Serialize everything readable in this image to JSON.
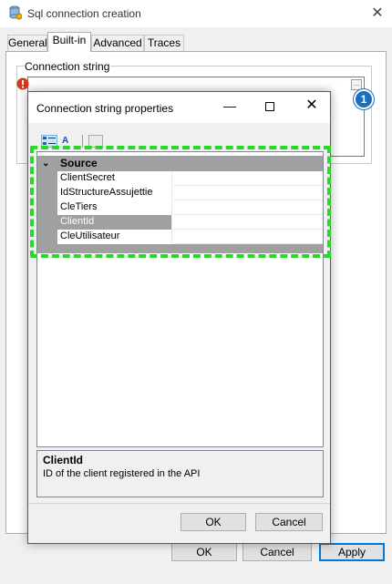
{
  "window": {
    "title": "Sql connection creation",
    "close_glyph": "✕",
    "title_icon": "database-settings-icon"
  },
  "tabs": [
    {
      "label": "General",
      "active": false
    },
    {
      "label": "Built-in",
      "active": true
    },
    {
      "label": "Advanced",
      "active": false
    },
    {
      "label": "Traces",
      "active": false
    }
  ],
  "connection": {
    "group_label": "Connection string",
    "value": "",
    "ellipsis_label": "...",
    "error_icon": "error-icon"
  },
  "badge": {
    "label": "1",
    "color": "#1c6fbf"
  },
  "footer": {
    "ok_label": "OK",
    "cancel_label": "Cancel",
    "apply_label": "Apply"
  },
  "dialog": {
    "title": "Connection string properties",
    "min_glyph": "—",
    "close_glyph": "✕",
    "toolbar": {
      "categorized_icon": "categorized-view-icon",
      "alpha_label": "A",
      "pages_icon": "property-pages-icon"
    },
    "category": {
      "label": "Source",
      "chevron": "⌄"
    },
    "properties": [
      {
        "name": "ClientSecret",
        "value": "",
        "selected": false
      },
      {
        "name": "IdStructureAssujettie",
        "value": "",
        "selected": false
      },
      {
        "name": "CleTiers",
        "value": "",
        "selected": false
      },
      {
        "name": "ClientId",
        "value": "",
        "selected": true
      },
      {
        "name": "CleUtilisateur",
        "value": "",
        "selected": false
      }
    ],
    "help": {
      "title": "ClientId",
      "description": "ID of the client registered in the API"
    },
    "ok_label": "OK",
    "cancel_label": "Cancel"
  },
  "colors": {
    "highlight": "#27d827",
    "grid_category": "#a0a0a0",
    "accent": "#0078d7"
  }
}
